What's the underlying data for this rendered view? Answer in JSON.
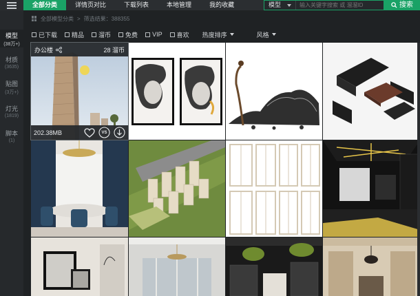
{
  "topbar": {
    "tabs": [
      {
        "label": "全部分类",
        "active": true
      },
      {
        "label": "详情页对比",
        "active": false
      },
      {
        "label": "下载列表",
        "active": false
      },
      {
        "label": "本地管理",
        "active": false
      },
      {
        "label": "我的收藏",
        "active": false
      }
    ],
    "search": {
      "type_value": "模型",
      "placeholder": "输入关键字搜索 或 溜溜ID",
      "button_label": "搜索"
    }
  },
  "sidebar": {
    "items": [
      {
        "label": "模型",
        "count": "(38万+)",
        "active": true
      },
      {
        "label": "材质",
        "count": "(3635)",
        "active": false
      },
      {
        "label": "贴图",
        "count": "(3万+)",
        "active": false
      },
      {
        "label": "灯光",
        "count": "(1819)",
        "active": false
      },
      {
        "label": "脚本",
        "count": "(1)",
        "active": false
      }
    ]
  },
  "breadcrumb": {
    "root": "全部模型分类",
    "result": "筛选结果：388355"
  },
  "filters": {
    "checkboxes": [
      "已下载",
      "精品",
      "溜币",
      "免费",
      "VIP",
      "喜欢"
    ],
    "sort_label": "热度排序",
    "style_label": "风格"
  },
  "hover_card": {
    "category": "办公楼",
    "price": "28 溜币",
    "size": "202.38MB",
    "vs_label": "VS"
  },
  "colors": {
    "accent": "#1aa266",
    "background": "#1f2224"
  },
  "icons": [
    "menu-icon",
    "grid-icon",
    "share-icon",
    "heart-icon",
    "download-icon",
    "search-icon"
  ]
}
